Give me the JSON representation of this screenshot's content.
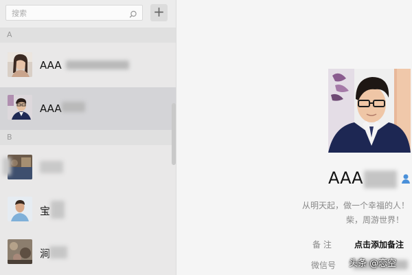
{
  "search": {
    "placeholder": "搜索"
  },
  "toolbar": {
    "add_label": "+"
  },
  "sections": [
    {
      "letter": "A"
    },
    {
      "letter": "B"
    }
  ],
  "contacts": [
    {
      "name": "AAA",
      "selected": false
    },
    {
      "name": "AAA",
      "selected": true
    },
    {
      "name": "",
      "selected": false
    },
    {
      "name": "宝",
      "selected": false
    },
    {
      "name": "涧",
      "selected": false
    }
  ],
  "profile": {
    "name": "AAA",
    "signature_line1": "从明天起，做一个幸福的人！",
    "signature_line2": "柴，周游世界！",
    "remark_label": "备  注",
    "remark_value": "点击添加备注",
    "wechat_id_label": "微信号"
  },
  "watermark": "头条 @恋空",
  "icons": {
    "search": "magnifier-icon",
    "profile_badge": "person-icon"
  },
  "colors": {
    "sidebar_bg": "#e9e8e8",
    "selected_row": "#d4d4d7",
    "accent_person": "#4a90d9"
  }
}
